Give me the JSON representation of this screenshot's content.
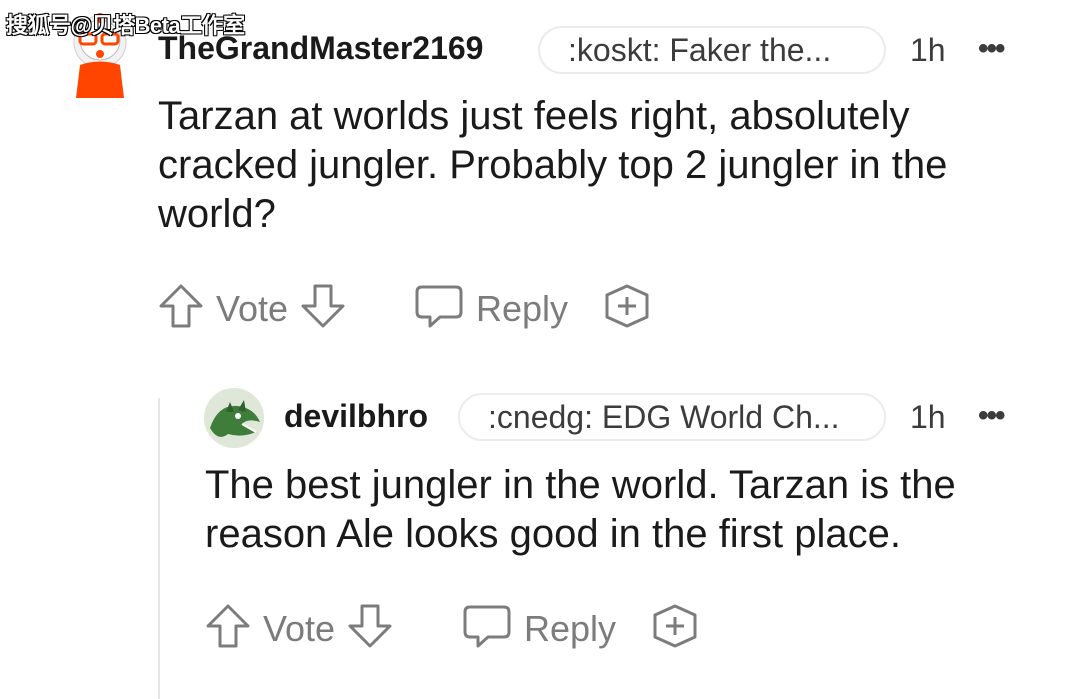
{
  "watermark": "搜狐号@贝塔Beta工作室",
  "comments": [
    {
      "username": "TheGrandMaster2169",
      "flair": ":koskt: Faker the...",
      "time": "1h",
      "more": "•••",
      "body_lines": [
        "Tarzan at worlds just feels right, absolutely",
        "cracked jungler. Probably top 2 jungler in the",
        "world?"
      ],
      "vote_label": "Vote",
      "reply_label": "Reply",
      "avatar_icon": "snoo-avatar-icon"
    },
    {
      "username": "devilbhro",
      "flair": ":cnedg: EDG World Ch...",
      "time": "1h",
      "more": "•••",
      "body_lines": [
        "The best jungler in the world. Tarzan is the",
        "reason Ale looks good in the first place."
      ],
      "vote_label": "Vote",
      "reply_label": "Reply",
      "avatar_icon": "dragon-avatar-icon"
    }
  ],
  "colors": {
    "text": "#1a1a1b",
    "meta": "#3c3c3c",
    "action": "#7c7c7c",
    "avatar1_accent": "#ff4500"
  }
}
